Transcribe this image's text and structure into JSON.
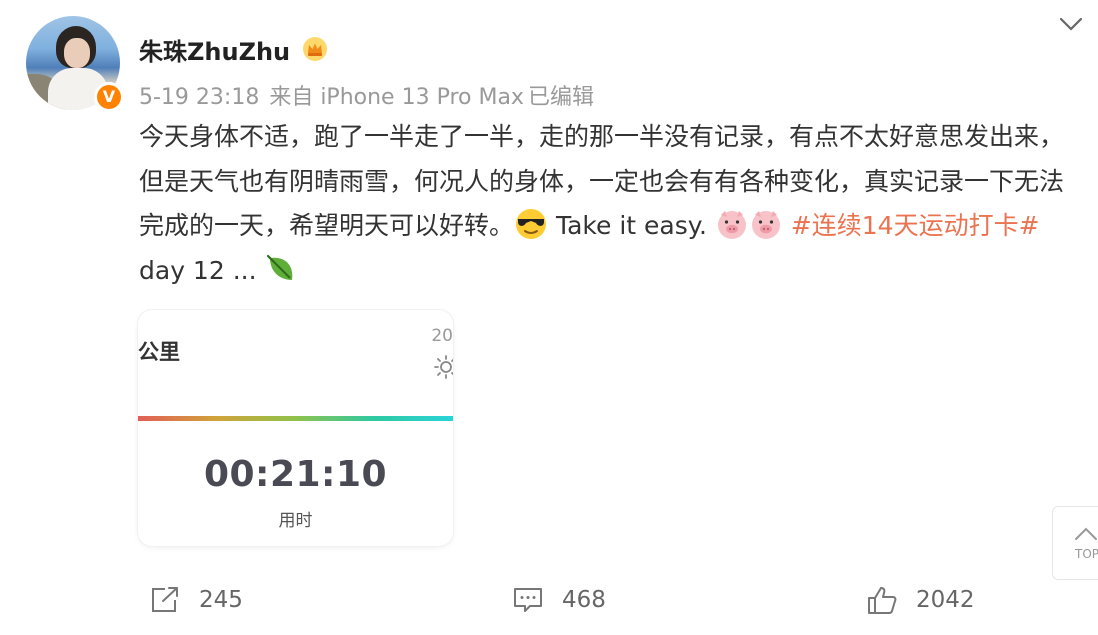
{
  "post": {
    "author": "朱珠ZhuZhu",
    "timestamp": "5-19 23:18",
    "source": "来自 iPhone 13 Pro Max",
    "edited": "已编辑",
    "text_part1": "今天身体不适，跑了一半走了一半，走的那一半没有记录，有点不太好意思发出来，但是天气也有阴晴雨雪，何况人的身体，一定也会有有各种变化，真实记录一下无法完成的一天，希望明天可以好转。",
    "text_part2": " Take it easy. ",
    "topic": "#连续14天运动打卡#",
    "text_part3": " day 12 ... ",
    "icons": [
      "v-badge-icon",
      "crown-icon",
      "chevron-down-icon",
      "sunglasses-emoji",
      "pig-emoji",
      "pig-emoji",
      "leaf-icon"
    ]
  },
  "card": {
    "top_text": "",
    "unit_label": "公里",
    "temperature": "20",
    "duration": "00:21:10",
    "duration_label": "用时"
  },
  "actions": {
    "repost_count": "245",
    "comment_count": "468",
    "like_count": "2042"
  },
  "back_to_top": {
    "label": "TOP"
  },
  "colors": {
    "topic": "#eb7350",
    "badge": "#ff8200",
    "meta": "#999999"
  }
}
